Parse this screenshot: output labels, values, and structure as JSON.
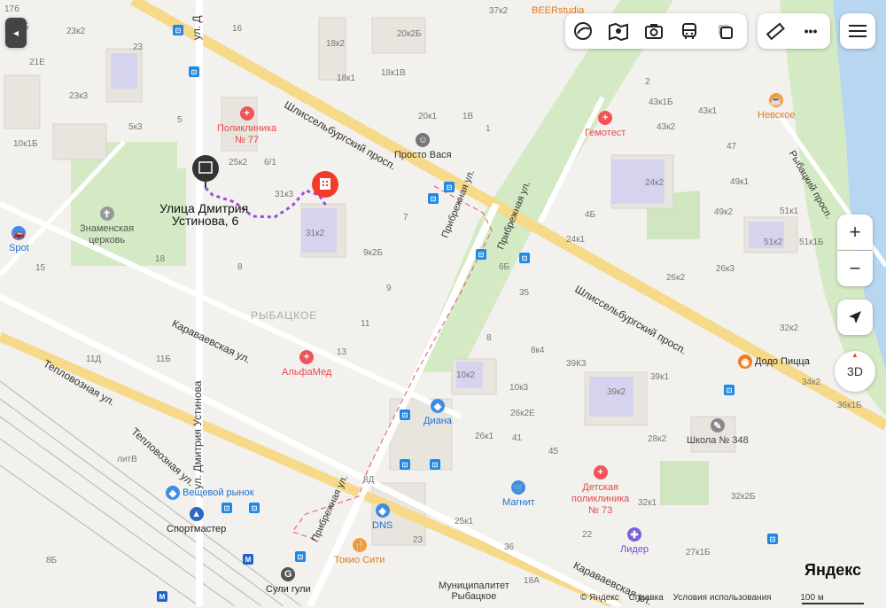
{
  "map": {
    "address_label_line1": "Улица Дмитрия",
    "address_label_line2": "Устинова, 6",
    "district": "РЫБАЦКОЕ",
    "streets": {
      "shlisselburg_1": "Шлиссельбургский просп.",
      "shlisselburg_2": "Шлиссельбургский просп.",
      "karavaevskaya_1": "Караваевская ул.",
      "karavaevskaya_2": "Караваевская ул.",
      "teplovoznaya_1": "Тепловозная ул.",
      "teplovoznaya_2": "Тепловозная ул.",
      "ustinova_1": "ул. Дмитрия Устинова",
      "ustinova_top": "ул. Д",
      "pribrezhnaya_1": "Прибрежная ул.",
      "pribrezhnaya_2": "Прибрежная ул.",
      "pribrezhnaya_3": "Прибрежная ул.",
      "rybatsky": "Рыбацкий просп."
    },
    "pois": {
      "polyclinic77": "Поликлиника\n№ 77",
      "znamenskaya": "Знаменская\nцерковь",
      "spot": "Spot",
      "prosto_vasya": "Просто Вася",
      "gemotest": "Гемотест",
      "nevskoe": "Невское",
      "beerstudia": "BEERstudia",
      "alfamed": "АльфаМед",
      "diana": "Диана",
      "dodo": "Додо Пицца",
      "school348": "Школа № 348",
      "children_poly": "Детская\nполиклиника\n№ 73",
      "magnit": "Магнит",
      "veshevoy": "Вещевой рынок",
      "sportmaster": "Спортмастер",
      "dns": "DNS",
      "tokio": "Токио Сити",
      "lider": "Лидер",
      "suli": "Сули гули",
      "municipality": "Муниципалитет\nРыбацкое"
    },
    "houses": [
      "17б",
      "23к2",
      "23",
      "21Е",
      "23к3",
      "23к2Б",
      "5",
      "5к3",
      "10к1Б",
      "16",
      "18к2",
      "18к1",
      "20к2Б",
      "18к1В",
      "37к2",
      "20к1",
      "1В",
      "1",
      "25к2",
      "6/1",
      "31к3",
      "31к2",
      "9к2Б",
      "7",
      "9",
      "8",
      "11",
      "13",
      "15",
      "18",
      "11Д",
      "11Б",
      "литВ",
      "2",
      "43к1Б",
      "43к1",
      "43к2",
      "47",
      "49к1",
      "24к2",
      "51к1",
      "4Б",
      "49к2",
      "24к1",
      "51к2",
      "51к1Б",
      "26к3",
      "6Б",
      "35",
      "26к2",
      "32к2",
      "8",
      "8к4",
      "39К3",
      "39к1",
      "39к2",
      "34к2",
      "36к1Б",
      "10к2",
      "10к3",
      "26к2Е",
      "26к1",
      "41",
      "28к2",
      "45",
      "32к2Б",
      "32к1",
      "22",
      "23",
      "25к1",
      "36",
      "27к1Б",
      "18А",
      "8Д",
      "8Б"
    ]
  },
  "toolbar": {
    "back_label": "◂",
    "layers_icon": "layers-icon",
    "panorama_icon": "panorama-icon",
    "camera_icon": "camera-icon",
    "transport_icon": "bus-icon",
    "traffic_icon": "traffic-icon",
    "ruler_icon": "ruler-icon",
    "more_label": "•••"
  },
  "controls": {
    "zoom_in": "+",
    "zoom_out": "−",
    "three_d": "3D"
  },
  "footer": {
    "copyright": "© Яндекс",
    "help": "Справка",
    "terms": "Условия использования",
    "scale": "100 м",
    "logo": "Яндекс"
  },
  "colors": {
    "accent_red": "#f33a2b",
    "bus_stop": "#1e88e5",
    "route_purple": "#9b4ed8",
    "road_main": "#f7d98a",
    "park_green": "#cfe6c0",
    "water": "#b8d6f0"
  }
}
